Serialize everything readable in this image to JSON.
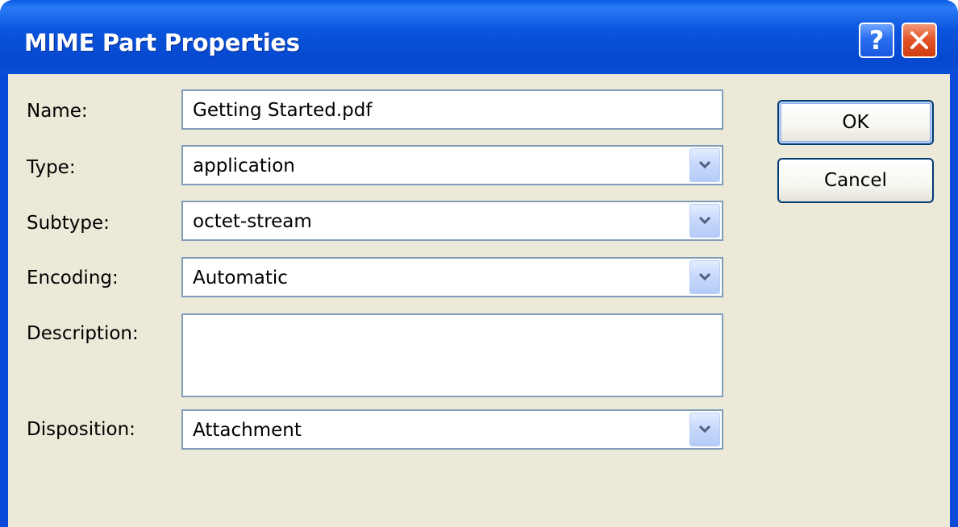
{
  "window": {
    "title": "MIME Part Properties",
    "help_label": "?"
  },
  "form": {
    "name_label": "Name:",
    "name_value": "Getting Started.pdf",
    "type_label": "Type:",
    "type_value": "application",
    "subtype_label": "Subtype:",
    "subtype_value": "octet-stream",
    "encoding_label": "Encoding:",
    "encoding_value": "Automatic",
    "description_label": "Description:",
    "description_value": "",
    "disposition_label": "Disposition:",
    "disposition_value": "Attachment"
  },
  "buttons": {
    "ok_label": "OK",
    "cancel_label": "Cancel"
  },
  "icons": {
    "help": "help-icon",
    "close": "close-icon",
    "dropdown": "chevron-down-icon"
  },
  "colors": {
    "titlebar": "#0a55dd",
    "client_background": "#ece9d8",
    "field_border": "#7f9db9",
    "close_button": "#e4552a"
  }
}
